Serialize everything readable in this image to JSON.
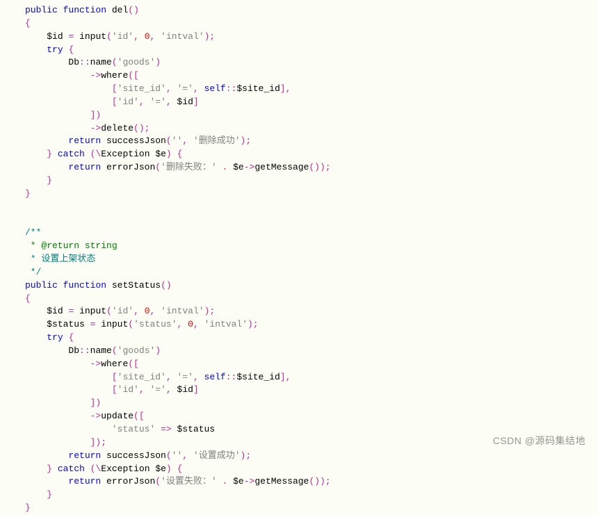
{
  "code": {
    "kw_public": "public",
    "kw_function": "function",
    "kw_try": "try",
    "kw_catch": "catch",
    "kw_return": "return",
    "kw_self": "self",
    "fn_del": "del",
    "fn_setStatus": "setStatus",
    "fn_input": "input",
    "fn_name": "name",
    "fn_where": "where",
    "fn_delete": "delete",
    "fn_update": "update",
    "fn_successJson": "successJson",
    "fn_errorJson": "errorJson",
    "fn_getMessage": "getMessage",
    "cls_Db": "Db",
    "cls_Exception": "Exception",
    "var_id": "$id",
    "var_status": "$status",
    "var_e": "$e",
    "var_site_id": "$site_id",
    "str_id": "'id'",
    "str_intval": "'intval'",
    "str_goods": "'goods'",
    "str_site_id": "'site_id'",
    "str_eq": "'='",
    "str_status": "'status'",
    "str_empty": "''",
    "str_del_ok": "'删除成功'",
    "str_del_fail": "'删除失败：'",
    "str_set_ok": "'设置成功'",
    "str_set_fail": "'设置失败：'",
    "num_zero": "0",
    "doc_open": "/**",
    "doc_return": " * @return string",
    "doc_desc": " * 设置上架状态",
    "doc_close": " */"
  },
  "watermark": "CSDN @源码集结地"
}
